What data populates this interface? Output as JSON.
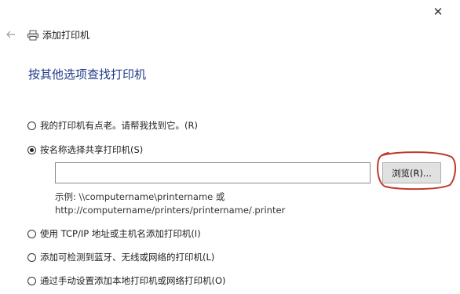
{
  "window": {
    "close_glyph": "✕",
    "back_icon": "back-arrow-icon",
    "title": "添加打印机",
    "title_icon": "printer-icon"
  },
  "heading": "按其他选项查找打印机",
  "options": [
    {
      "label": "我的打印机有点老。请帮我找到它。(R)",
      "checked": false
    },
    {
      "label": "按名称选择共享打印机(S)",
      "checked": true
    },
    {
      "label": "使用 TCP/IP 地址或主机名添加打印机(I)",
      "checked": false
    },
    {
      "label": "添加可检测到蓝牙、无线或网络的打印机(L)",
      "checked": false
    },
    {
      "label": "通过手动设置添加本地打印机或网络打印机(O)",
      "checked": false
    }
  ],
  "share_input": {
    "value": "",
    "placeholder": ""
  },
  "browse_button": "浏览(R)...",
  "example": {
    "line1": "示例: \\\\computername\\printername 或",
    "line2": "http://computername/printers/printername/.printer"
  },
  "colors": {
    "heading": "#1f3a8a",
    "annotation": "#c0392b"
  }
}
